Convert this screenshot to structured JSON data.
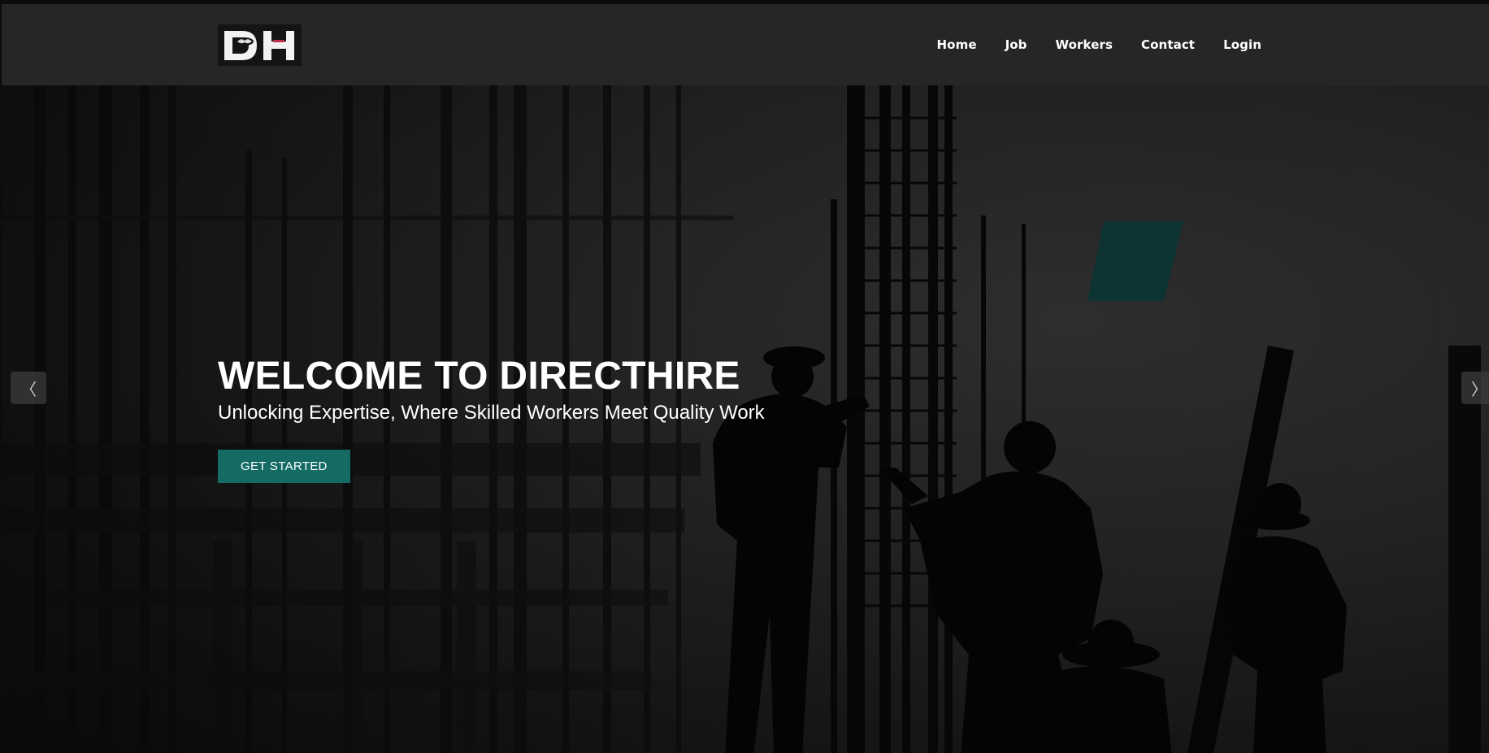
{
  "header": {
    "logo_text": "DH",
    "nav": [
      {
        "label": "Home"
      },
      {
        "label": "Job"
      },
      {
        "label": "Workers"
      },
      {
        "label": "Contact"
      },
      {
        "label": "Login"
      }
    ]
  },
  "hero": {
    "title": "WELCOME TO DIRECTHIRE",
    "subtitle": "Unlocking Expertise, Where Skilled Workers Meet Quality Work",
    "cta_label": "GET STARTED",
    "prev_icon": "chevron-left-icon",
    "next_icon": "chevron-right-icon",
    "prev_glyph": "〈",
    "next_glyph": "〉"
  },
  "colors": {
    "header_bg": "#262626",
    "accent": "#136b64",
    "teal_panel": "#0f3a3a"
  }
}
